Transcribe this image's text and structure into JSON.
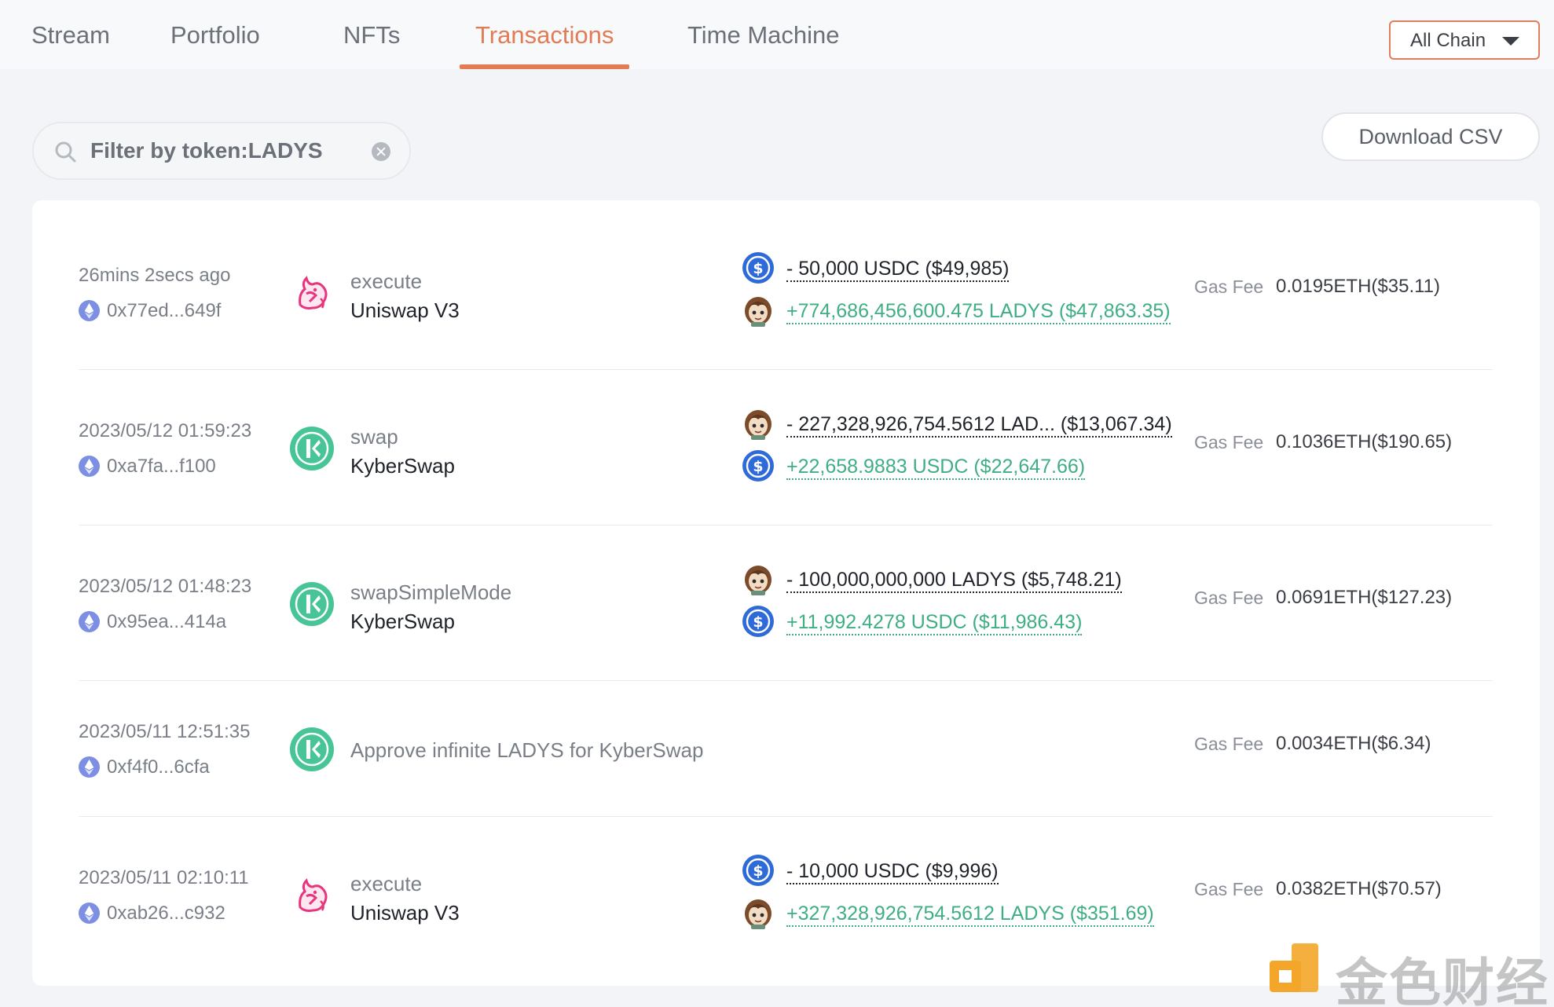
{
  "nav": {
    "tabs": [
      {
        "label": "Stream"
      },
      {
        "label": "Portfolio"
      },
      {
        "label": "NFTs"
      },
      {
        "label": "Transactions"
      },
      {
        "label": "Time Machine"
      }
    ],
    "active_tab": "Transactions",
    "chain_selector": "All Chain"
  },
  "filter": {
    "text": "Filter by token:LADYS"
  },
  "download_csv": "Download CSV",
  "colors": {
    "accent": "#e37b55",
    "incoming": "#3fae84",
    "outgoing": "#1f2329"
  },
  "transactions": [
    {
      "time": "26mins 2secs ago",
      "hash": "0x77ed...649f",
      "method": "execute",
      "protocol": "Uniswap V3",
      "protocol_icon": "uniswap-icon",
      "transfers": [
        {
          "amount": "- 50,000 USDC ($49,985)",
          "token_icon": "usdc-icon",
          "direction": "out"
        },
        {
          "amount": "+774,686,456,600.475 LADYS ($47,863.35)",
          "token_icon": "ladys-icon",
          "direction": "in"
        }
      ],
      "gas_label": "Gas Fee",
      "gas_fee": "0.0195ETH($35.11)"
    },
    {
      "time": "2023/05/12 01:59:23",
      "hash": "0xa7fa...f100",
      "method": "swap",
      "protocol": "KyberSwap",
      "protocol_icon": "kyberswap-icon",
      "transfers": [
        {
          "amount": "- 227,328,926,754.5612 LAD... ($13,067.34)",
          "token_icon": "ladys-icon",
          "direction": "out"
        },
        {
          "amount": "+22,658.9883 USDC ($22,647.66)",
          "token_icon": "usdc-icon",
          "direction": "in"
        }
      ],
      "gas_label": "Gas Fee",
      "gas_fee": "0.1036ETH($190.65)"
    },
    {
      "time": "2023/05/12 01:48:23",
      "hash": "0x95ea...414a",
      "method": "swapSimpleMode",
      "protocol": "KyberSwap",
      "protocol_icon": "kyberswap-icon",
      "transfers": [
        {
          "amount": "- 100,000,000,000 LADYS ($5,748.21)",
          "token_icon": "ladys-icon",
          "direction": "out"
        },
        {
          "amount": "+11,992.4278 USDC ($11,986.43)",
          "token_icon": "usdc-icon",
          "direction": "in"
        }
      ],
      "gas_label": "Gas Fee",
      "gas_fee": "0.0691ETH($127.23)"
    },
    {
      "time": "2023/05/11 12:51:35",
      "hash": "0xf4f0...6cfa",
      "approve": "Approve infinite LADYS for KyberSwap",
      "protocol_icon": "kyberswap-icon",
      "gas_label": "Gas Fee",
      "gas_fee": "0.0034ETH($6.34)"
    },
    {
      "time": "2023/05/11 02:10:11",
      "hash": "0xab26...c932",
      "method": "execute",
      "protocol": "Uniswap V3",
      "protocol_icon": "uniswap-icon",
      "transfers": [
        {
          "amount": "- 10,000 USDC ($9,996)",
          "token_icon": "usdc-icon",
          "direction": "out"
        },
        {
          "amount": "+327,328,926,754.5612 LADYS ($351.69)",
          "token_icon": "ladys-icon",
          "direction": "in"
        }
      ],
      "gas_label": "Gas Fee",
      "gas_fee": "0.0382ETH($70.57)"
    }
  ],
  "watermark": {
    "logo_text": "金色财经"
  }
}
